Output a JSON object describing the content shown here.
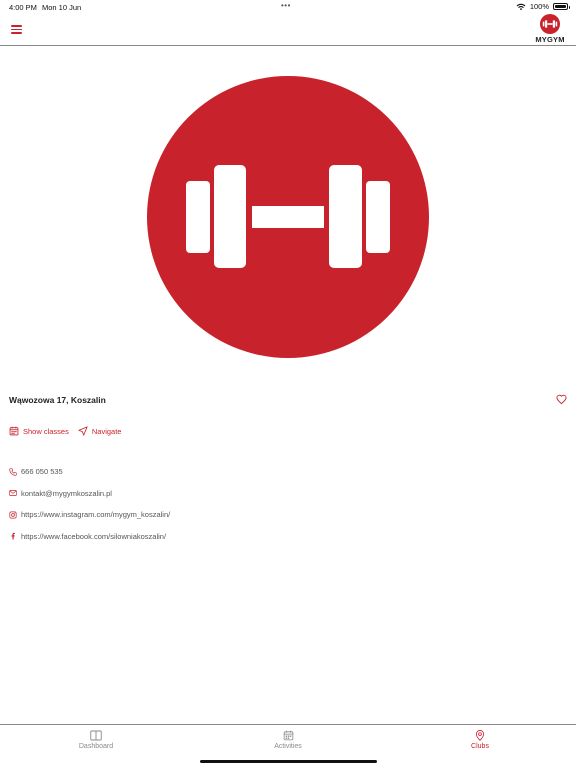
{
  "status_bar": {
    "time": "4:00 PM",
    "date": "Mon 10 Jun",
    "battery": "100%"
  },
  "header": {
    "logo_text": "MYGYM"
  },
  "brand": {
    "accent": "#c8232c"
  },
  "club": {
    "address": "Wąwozowa 17, Koszalin"
  },
  "actions": {
    "show_classes": "Show classes",
    "navigate": "Navigate"
  },
  "contacts": {
    "phone": "666 050 535",
    "email": "kontakt@mygymkoszalin.pl",
    "instagram": "https://www.instagram.com/mygym_koszalin/",
    "facebook": "https://www.facebook.com/silowniakoszalin/"
  },
  "tabs": [
    {
      "label": "Dashboard",
      "icon": "book-open-icon"
    },
    {
      "label": "Activities",
      "icon": "calendar-icon"
    },
    {
      "label": "Clubs",
      "icon": "location-pin-icon",
      "active": true
    }
  ]
}
